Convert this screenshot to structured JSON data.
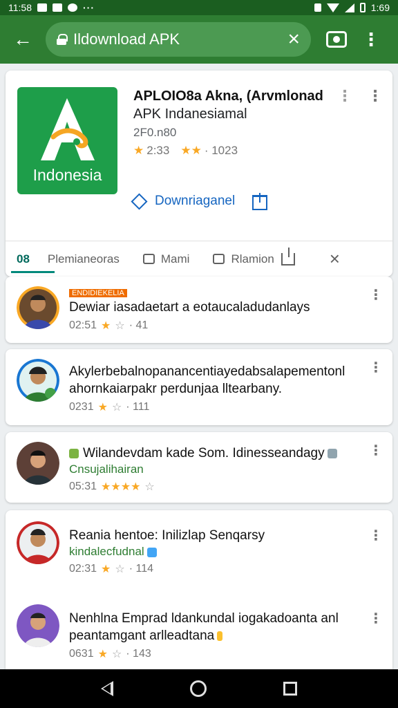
{
  "status_bar": {
    "time_left": "11:58",
    "more_dots": "···",
    "time_right": "1:69"
  },
  "toolbar": {
    "back_icon": "arrow-left-icon",
    "url_text": "Ildownload APK",
    "clear_icon": "close-icon",
    "camera_icon": "camera-icon",
    "menu_icon": "more-vert-icon"
  },
  "app": {
    "icon_label": "Indonesia",
    "title_line1": "APLOIO8a Akna, (Arvmlonad",
    "title_line2": "APK Indanesiamal",
    "meta": "2F0.n80",
    "rating_text1": "2:33",
    "rating_text2": "· 1023",
    "download_label": "Downriaganel"
  },
  "tabs": {
    "active_count": "08",
    "tab1": "Plemianeoras",
    "tab2": "Mami",
    "tab3": "Rlamion"
  },
  "reviews": [
    {
      "badge": "ENDIDIEKELIA",
      "text": "Dewiar iasadaetart a eotaucaladudanlays",
      "sub": "",
      "time": "02:51",
      "rating": "· 41"
    },
    {
      "badge": "",
      "text": "Akylerbebalnopanancentiayedabsalapementonl ahornkaiarpakr perdunjaa lltearbany.",
      "sub": "",
      "time": "0231",
      "rating": "· 111"
    },
    {
      "badge": "",
      "text": "Wilandevdam kade Som. Idinesseandagy",
      "sub": "Cnsujalihairan",
      "time": "05:31",
      "rating": ""
    },
    {
      "badge": "",
      "text": "Reania hentoe: Inilizlap Senqarsy",
      "sub": "kindalecfudnal",
      "time": "02:31",
      "rating": "· 114"
    },
    {
      "badge": "",
      "text": "Nenhlna Emprad ldankundal iogakadoanta anl peantamgant arlleadtana",
      "sub": "",
      "time": "0631",
      "rating": "· 143"
    }
  ],
  "colors": {
    "status_bar": "#1b5e20",
    "toolbar": "#2e7d32",
    "accent": "#00897b",
    "app_icon": "#1e9e4a",
    "star": "#f9a825",
    "link": "#1565c0"
  }
}
